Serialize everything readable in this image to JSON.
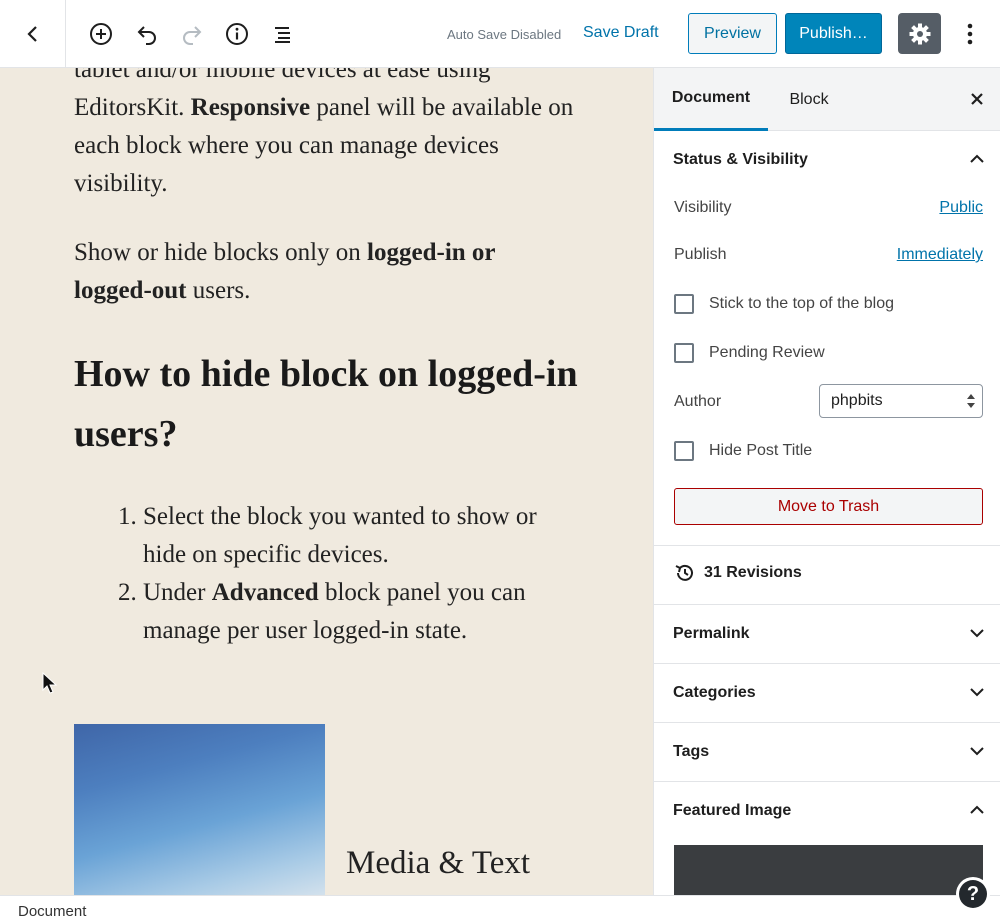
{
  "toolbar": {
    "back_icon": "chevron-left-icon",
    "add_icon": "plus-circle-icon",
    "undo_icon": "undo-icon",
    "redo_icon": "redo-icon",
    "info_icon": "info-icon",
    "outline_icon": "list-view-icon",
    "autosave_text": "Auto Save Disabled",
    "save_draft_label": "Save Draft",
    "preview_label": "Preview",
    "publish_label": "Publish…",
    "settings_icon": "gear-icon",
    "more_icon": "more-vertical-icon"
  },
  "content": {
    "p1": {
      "pre": "tablet and/or mobile devices at ease using EditorsKit. ",
      "bold": "Responsive",
      "post": " panel will be available on each block where you can manage devices visibility."
    },
    "p2": {
      "pre": "Show or hide blocks only on ",
      "bold": "logged-in or logged-out",
      "post": " users."
    },
    "heading": "How to hide block on logged-in users?",
    "list": [
      {
        "num": "1.",
        "pre": "Select the block you wanted to show or hide on specific devices.",
        "bold": "",
        "post": ""
      },
      {
        "num": "2.",
        "pre": "Under ",
        "bold": "Advanced",
        "post": " block panel you can manage per user logged-in state."
      }
    ],
    "media_text": "Media & Text"
  },
  "sidebar": {
    "tabs": [
      "Document",
      "Block"
    ],
    "close_icon": "close-icon",
    "status": {
      "title": "Status & Visibility",
      "visibility_label": "Visibility",
      "visibility_value": "Public",
      "publish_label": "Publish",
      "publish_value": "Immediately",
      "sticky_label": "Stick to the top of the blog",
      "pending_label": "Pending Review",
      "author_label": "Author",
      "author_value": "phpbits",
      "hide_title_label": "Hide Post Title",
      "trash_label": "Move to Trash"
    },
    "revisions_label": "31 Revisions",
    "panels": [
      "Permalink",
      "Categories",
      "Tags"
    ],
    "featured_image_title": "Featured Image"
  },
  "footer": {
    "breadcrumb": "Document",
    "help_label": "?"
  },
  "colors": {
    "accent": "#007cba",
    "publish": "#0085ba",
    "editor_bg": "#f0eadf",
    "trash": "#aa0000"
  }
}
